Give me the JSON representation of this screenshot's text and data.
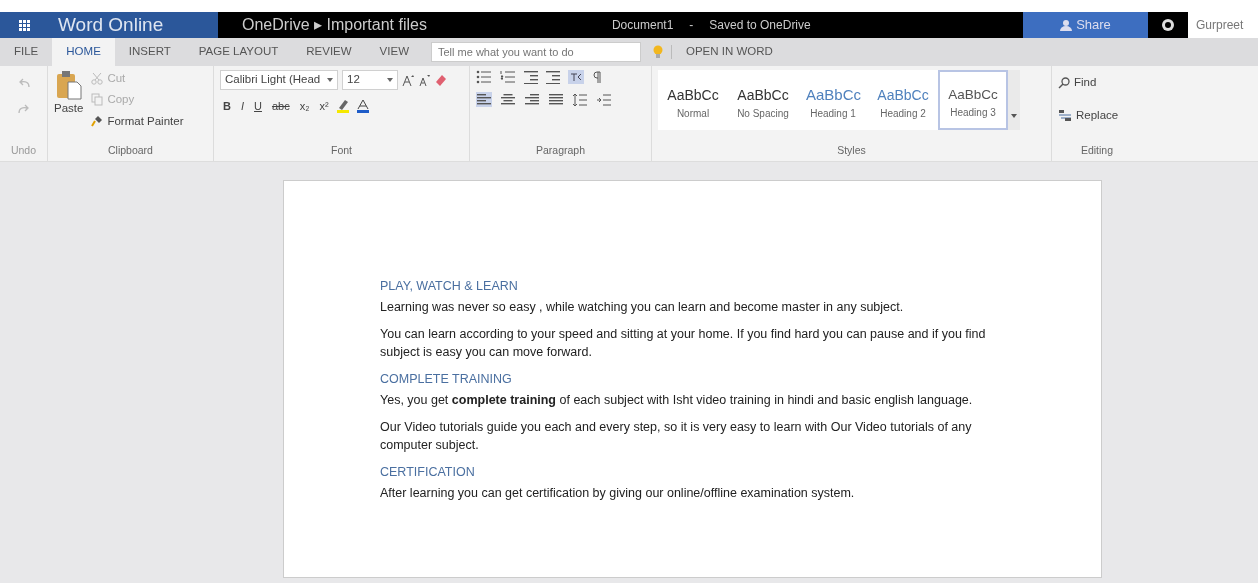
{
  "app_bar": {
    "app_name": "Word Online",
    "breadcrumb": "OneDrive ▸ Important files",
    "document_name": "Document1",
    "separator": "-",
    "save_status": "Saved to OneDrive",
    "share_label": "Share",
    "user_name": "Gurpreet"
  },
  "tabs": [
    {
      "label": "FILE",
      "selected": false
    },
    {
      "label": "HOME",
      "selected": true
    },
    {
      "label": "INSERT",
      "selected": false
    },
    {
      "label": "PAGE LAYOUT",
      "selected": false
    },
    {
      "label": "REVIEW",
      "selected": false
    },
    {
      "label": "VIEW",
      "selected": false
    }
  ],
  "tell_me": {
    "placeholder": "Tell me what you want to do"
  },
  "open_in_word": "OPEN IN WORD",
  "ribbon": {
    "undo": {
      "label": "Undo",
      "disabled": true
    },
    "clipboard": {
      "label": "Clipboard",
      "paste": "Paste",
      "items": [
        {
          "label": "Cut",
          "disabled": true
        },
        {
          "label": "Copy",
          "disabled": true
        },
        {
          "label": "Format Painter",
          "disabled": false
        }
      ]
    },
    "font": {
      "label": "Font",
      "font_name": "Calibri Light (Head",
      "font_size": "12",
      "format_buttons": [
        "B",
        "I",
        "U",
        "abc",
        "x₂",
        "x²"
      ]
    },
    "paragraph": {
      "label": "Paragraph"
    },
    "styles": {
      "label": "Styles",
      "items": [
        {
          "sample": "AaBbCc",
          "name": "Normal",
          "kind": "body",
          "selected": false
        },
        {
          "sample": "AaBbCc",
          "name": "No Spacing",
          "kind": "body",
          "selected": false
        },
        {
          "sample": "AaBbCc",
          "name": "Heading 1",
          "kind": "heading1",
          "selected": false
        },
        {
          "sample": "AaBbCc",
          "name": "Heading 2",
          "kind": "heading2",
          "selected": false
        },
        {
          "sample": "AaBbCc",
          "name": "Heading 3",
          "kind": "heading3",
          "selected": true
        }
      ]
    },
    "editing": {
      "label": "Editing",
      "find": "Find",
      "replace": "Replace"
    }
  },
  "document": [
    {
      "kind": "heading",
      "text": "PLAY, WATCH & LEARN"
    },
    {
      "kind": "paragraph",
      "text": "Learning was never so easy , while watching you can learn and become master in any subject."
    },
    {
      "kind": "paragraph",
      "text": "You can learn according to your speed and sitting at your home. If you find hard you can pause and if you find subject is easy you can move forward."
    },
    {
      "kind": "heading",
      "text": "COMPLETE TRAINING"
    },
    {
      "kind": "paragraph",
      "text": "Yes, you get **complete training** of each subject with Isht video training in hindi and basic english language."
    },
    {
      "kind": "paragraph",
      "text": "Our Video tutorials guide you each and every step, so it is very easy to learn with Our Video tutorials of any computer subject."
    },
    {
      "kind": "heading",
      "text": "CERTIFICATION"
    },
    {
      "kind": "paragraph",
      "text": "After learning you can get certification by giving our online/offline examination system."
    }
  ]
}
